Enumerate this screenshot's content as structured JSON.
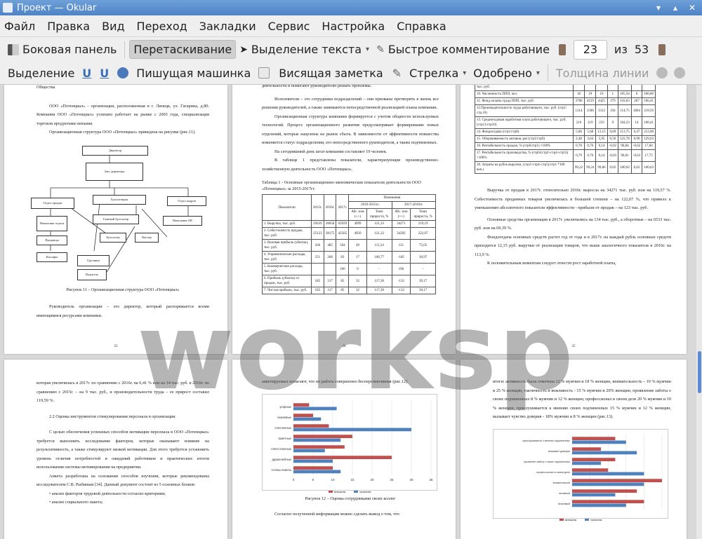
{
  "window": {
    "title": "Проект — Okular"
  },
  "menu": [
    "Файл",
    "Правка",
    "Вид",
    "Переход",
    "Закладки",
    "Сервис",
    "Настройка",
    "Справка"
  ],
  "toolbar1": {
    "sidebar": "Боковая панель",
    "browse": "Перетаскивание",
    "text_select": "Выделение текста",
    "quick_annot": "Быстрое комментирование",
    "page_current": "23",
    "page_of": "из",
    "page_total": "53"
  },
  "toolbar2": {
    "highlight": "Выделение",
    "typewriter": "Пишущая машинка",
    "popup_note": "Висящая заметка",
    "arrow": "Стрелка",
    "stamp": "Одобрено",
    "line_width": "Толщина линии"
  },
  "watermark": "worksp",
  "colors": {
    "red": "#c0504d",
    "blue": "#4f81bd",
    "accent": "#5b8bd4"
  },
  "page1": {
    "heading": "Общества",
    "p1": "ООО «Потенциал» - организация, расположенная в г. Липецк, ул. Гагарина, д.80. Компания ООО «Потенциал» успешно работает на рынке с 2003 года, специализация торговля продуктами питания.",
    "p2": "Организационная структура ООО «Потенциал» приведена на рисунке (рис.11).",
    "org": [
      "Директор",
      "Зам. директора",
      "Отдел продаж",
      "Бухгалтерия",
      "Отдел кадров",
      "Начальник отдела",
      "Главный бухгалтер",
      "Начальник ОК",
      "Продавцы",
      "Бухгалтер",
      "Кассир",
      "Кассиры",
      "Грузчики",
      "Водитель"
    ],
    "caption": "Рисунок 11 – Организационная структура ООО «Потенциал»",
    "p3": "Руководитель организации – это директор, который распоряжается всеми имеющимися ресурсами компании.",
    "num": "23"
  },
  "page2": {
    "p1": "деятельности и помогают руководителю решать проблемы.",
    "p2": "Исполнители – это сотрудники подразделений – они призваны претворить в жизнь все решения руководителей, а также занимаются непосредственной реализацией планы компании.",
    "p3": "Организационная структура компании формируется с учетом общности используемых технологий. Процесс организационного развития предусматривает формирование новых отделений, которые нацелены на рынок сбыта. В зависимости от эффективности новшества изменяется статус подразделения, его непосредственного руководителя, а также подчиненных.",
    "p4": "На сегодняшний день штат компании составляет 19 человек.",
    "p5": "В таблице 1 представлены показатели, характеризующие производственно-хозяйственную деятельность ООО «Потенциал».",
    "table_title": "Таблица 1 - Основные организационно-экономические показатели деятельности ООО «Потенциал» за 2015-2017гг.",
    "headers": [
      "Показатели",
      "2015г.",
      "2016г.",
      "2017г.",
      "Изменения",
      "2016-2015гг.",
      "2017-2016гг.",
      "Абс. изм (+/-)",
      "Темп прироста, %",
      "Абс. изм (+/-)",
      "Темп прироста, %"
    ],
    "rows": [
      [
        "1. Выручка, тыс. руб.",
        "29439",
        "28658",
        "62929",
        "4999",
        "121,33",
        "34271",
        "219,19"
      ],
      [
        "2. Себестоимость продаж, тыс. руб.",
        "25123",
        "28175",
        "42565",
        "4950",
        "121,32",
        "34392",
        "222,07"
      ],
      [
        "3. Валовая прибыль (убыток), тыс. руб.",
        "436",
        "485",
        "564",
        "49",
        "111,24",
        "121",
        "75,05"
      ],
      [
        "4. Управленческие расходы, тыс. руб.",
        "251",
        "268",
        "83",
        "17",
        "106,77",
        "-185",
        "30,97"
      ],
      [
        "5. Коммерческие расходы, тыс. руб.",
        "",
        "",
        "196",
        "0",
        "-",
        "196",
        "-"
      ],
      [
        "6. Прибыль (убыток) от продаж, тыс. руб.",
        "185",
        "217",
        "85",
        "32",
        "117,30",
        "-132",
        "39,17"
      ],
      [
        "7. Чистая прибыль, тыс. руб.",
        "185",
        "217",
        "85",
        "32",
        "117,30",
        "-132",
        "39,17"
      ]
    ],
    "num": "24"
  },
  "page3": {
    "rows": [
      [
        "тыс. руб.",
        "",
        "",
        "",
        "",
        "",
        "",
        ""
      ],
      [
        "10. Численность ППП, чел.",
        "18",
        "19",
        "19",
        "1",
        "105,56",
        "0",
        "100,00"
      ],
      [
        "11. Фонд оплаты труда ППП, тыс. руб.",
        "3780",
        "4159",
        "4425",
        "379",
        "110,03",
        "267",
        "106,41"
      ],
      [
        "12.Производительность труда работающего, тыс. руб. (стр1/стр.10)",
        "1314",
        "1508",
        "3312",
        "194",
        "114,75",
        "1804",
        "219,59"
      ],
      [
        "13. Среднегодовая заработная плата работающего, тыс. руб. (стр11/стр10)",
        "210",
        "219",
        "233",
        "9",
        "104,23",
        "14",
        "106,41"
      ],
      [
        "14. Фондоотдача (стр1/стр8)",
        "5,00",
        "5,68",
        "12,15",
        "0,69",
        "113,75",
        "6,47",
        "213,90"
      ],
      [
        "15. Оборачиваемость активов, раз (стр1/стр9)",
        "2,48",
        "3,04",
        "5,95",
        "0,56",
        "122,78",
        "0,90",
        "129,63"
      ],
      [
        "16. Рентабельность продаж, % (стр6/стр1) ×100%",
        "0,78",
        "0,76",
        "0,14",
        "-0,02",
        "96,84",
        "-0,62",
        "17,84"
      ],
      [
        "17. Рентабельность производства, % (стр6/(стр2+стр4+стр5)) ×100%",
        "0,79",
        "0,76",
        "0,14",
        "-0,03",
        "96,81",
        "-0,63",
        "17,75"
      ],
      [
        "18. Затраты на рубль выручки, (стр2+стр4+стр5)/стр1 *100 коп.)",
        "99,22",
        "99,24",
        "99,86",
        "0,02",
        "100,02",
        "0,62",
        "100,63"
      ]
    ],
    "p1": "Выручка от продаж в 2017г. относительно 2016г. выросла на 34271 тыс. руб. или на 119,57 %. Себестоимость проданных товаров увеличилась в большей степени – на 122,07 %, что привело к уменьшению абсолютного показателя эффективности - прибыли от продаж – на 123 тыс. руб.",
    "p2": "Основные средства организации в 2017г. увеличились на 134 тыс. руб., а оборотные – на 6533 тыс. руб. или на 69,39 %.",
    "p3": "Фондоотдача основных средств растет год от года и в 2017г. на каждый рубль основных средств приходится 12,15 руб. выручки от реализации товаров, что выше аналогичного показателя в 2016г. на 113,9 %.",
    "p4": "К положительным моментам следует отнести рост заработной платы,",
    "num": "25"
  },
  "page4": {
    "p1": "которая увеличилась в 2017г. по сравнению с 2016г. на 6,41 % или на 14 тыс. руб. в 2016г. по сравнению с 2015г. – на 9 тыс. руб., и производительности труда – ее прирост составил 119,59 %.",
    "heading": "2.2 Оценка инструментов стимулирования персонала в организации",
    "p2": "С целью обеспечения успешных способов мотивации персонала в ООО «Потенциал» требуется выполнить исследование факторов, которые оказывают влияние на результативность, а также стимулируют низкой мотивации. Для этого требуется установить уровень отличия потребностей и ожиданий работников и практических итогов использования системы мотивирования на предприятии.",
    "p3": "Анкета разработана на основании способов изучения, которые рекомендованы исследователем С.В. Рыбиным [34]. Данный документ состоит из 5 основных блоков:",
    "b1": "анализ факторов трудовой деятельности согласно критериям;",
    "b2": "анализ социального пакета;"
  },
  "page5": {
    "p1": "анкетируемых полагают, что их работа совершенно бесперспективная (рис.12).",
    "cats": [
      "упорные",
      "вежливые",
      "сплоченные",
      "приятные",
      "ответственные",
      "дружелюбные",
      "готовы помочь"
    ],
    "red": [
      4,
      5,
      9,
      15,
      13,
      25,
      10
    ],
    "blue": [
      11,
      7,
      30,
      12,
      8,
      10,
      12
    ],
    "ticks": [
      "0",
      "5",
      "10",
      "15",
      "20",
      "25",
      "30",
      "35"
    ],
    "legend_red": "женщины",
    "legend_blue": "мужчины",
    "caption": "Рисунок 12 – Оценка сотрудниками своих коллег",
    "p2": "Согласно полученной информации можно сделать вывод о том, что"
  },
  "page6": {
    "p1": "итоги: активность была отмечена 12 % мужчин и 18 % женщин, внимательность – 10 % мужчин и 25 % женщин, тактичность и вежливость - 15 % мужчин и 20% женщин, проявление заботы о своих подчиненных 8 % мужчин и 12 % женщин, профессионал в своем деле 20 % мужчин и 10 % женщин, прислушивается к мнению своих подчиненных 15 % мужчин и 12 % женщин, вызывает чувство доверия - 18% мужчин и 8 % женщин (рис.13).",
    "cats": [
      "прислушивается к мнению подчиненных",
      "вызывает доверие",
      "проявляет заботу о своих подчиненных",
      "профессионал в своем деле",
      "внимательный",
      "активный",
      "вежливый"
    ],
    "red": [
      12,
      8,
      12,
      10,
      25,
      18,
      20
    ],
    "blue": [
      15,
      18,
      8,
      20,
      20,
      12,
      15
    ],
    "legend_red": "женщины",
    "legend_blue": "мужчины"
  }
}
